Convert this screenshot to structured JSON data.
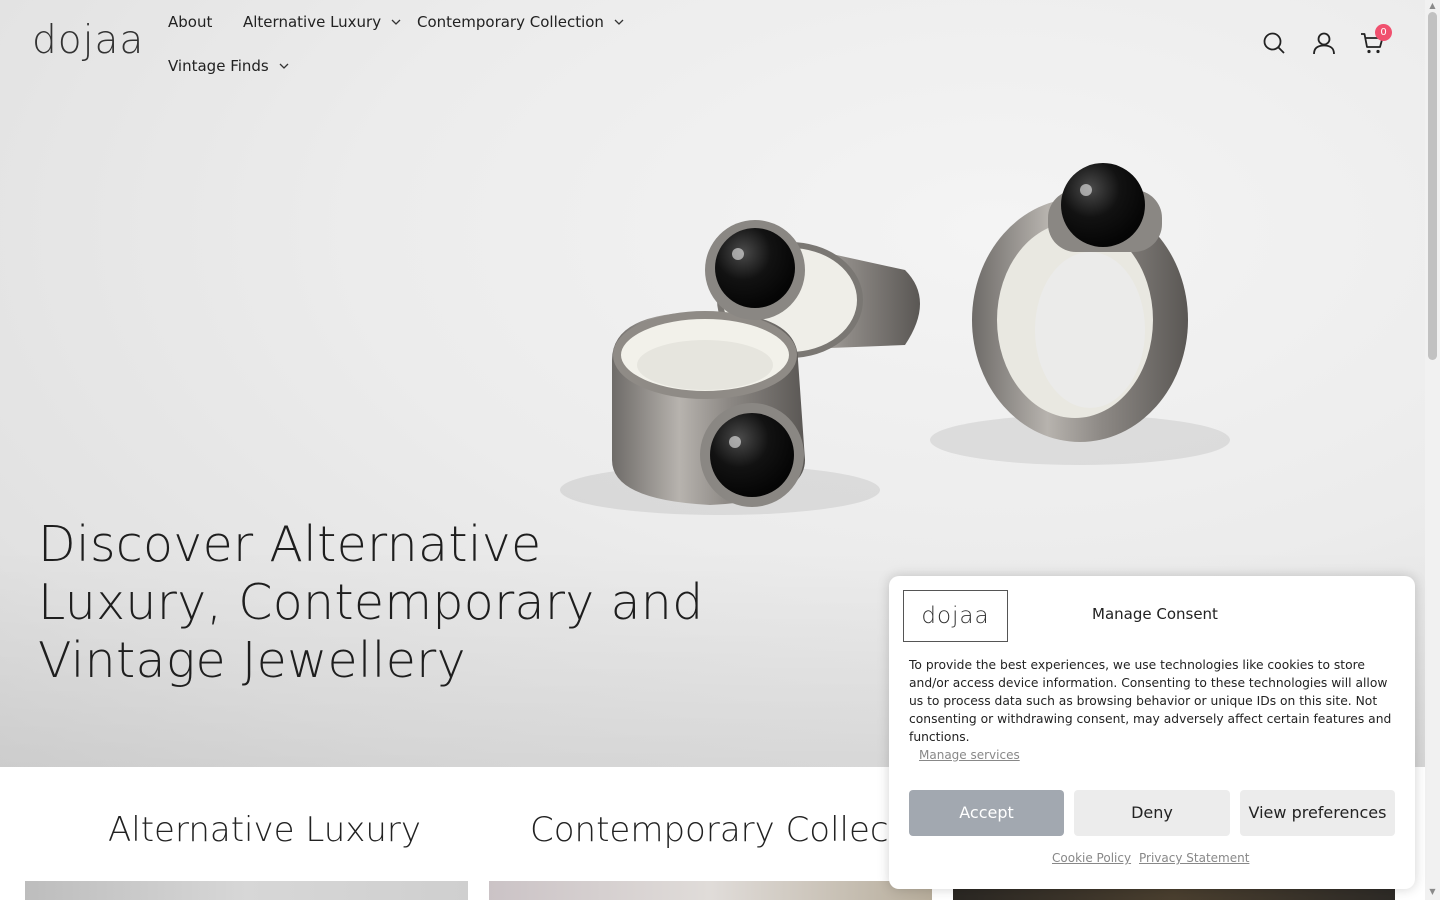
{
  "header": {
    "logo": "dojaa",
    "nav": [
      {
        "label": "About",
        "has_dropdown": false
      },
      {
        "label": "Alternative Luxury",
        "has_dropdown": true
      },
      {
        "label": "Contemporary Collection",
        "has_dropdown": true
      },
      {
        "label": "Vintage Finds",
        "has_dropdown": true
      }
    ],
    "icons": [
      "search-icon",
      "account-icon",
      "cart-icon"
    ],
    "cart_count": "0"
  },
  "hero": {
    "title": "Discover Alternative Luxury, Contemporary and Vintage Jewellery"
  },
  "sections": [
    {
      "title": "Alternative Luxury"
    },
    {
      "title": "Contemporary Collection"
    }
  ],
  "consent": {
    "logo": "dojaa",
    "title": "Manage Consent",
    "text": "To provide the best experiences, we use technologies like cookies to store and/or access device information. Consenting to these technologies will allow us to process data such as browsing behavior or unique IDs on this site. Not consenting or withdrawing consent, may adversely affect certain features and functions.",
    "manage_services": "Manage services",
    "accept": "Accept",
    "deny": "Deny",
    "view_preferences": "View preferences",
    "cookie_policy": "Cookie Policy",
    "privacy_statement": "Privacy Statement"
  },
  "colors": {
    "badge": "#f0506e",
    "accept_button": "#a2a8b0",
    "secondary_button": "#ececec"
  }
}
